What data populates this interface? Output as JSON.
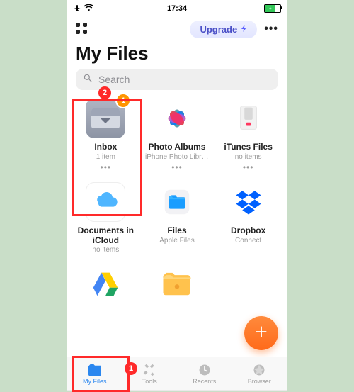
{
  "status": {
    "time": "17:34"
  },
  "header": {
    "upgrade_label": "Upgrade",
    "title": "My Files"
  },
  "search": {
    "placeholder": "Search"
  },
  "folders": [
    {
      "name": "Inbox",
      "sub": "1 item",
      "icon": "inbox",
      "badge": "1"
    },
    {
      "name": "Photo Albums",
      "sub": "iPhone Photo Libra...",
      "icon": "flower",
      "badge": null
    },
    {
      "name": "iTunes Files",
      "sub": "no items",
      "icon": "itunes",
      "badge": null
    },
    {
      "name": "Documents in iCloud",
      "sub": "no items",
      "icon": "doccloud",
      "badge": null
    },
    {
      "name": "Files",
      "sub": "Apple Files",
      "icon": "files",
      "badge": null
    },
    {
      "name": "Dropbox",
      "sub": "Connect",
      "icon": "dropbox",
      "badge": null
    },
    {
      "name": "",
      "sub": "",
      "icon": "gdrive",
      "badge": null
    },
    {
      "name": "",
      "sub": "",
      "icon": "folder",
      "badge": null
    }
  ],
  "tabs": [
    {
      "label": "My Files"
    },
    {
      "label": "Tools"
    },
    {
      "label": "Recents"
    },
    {
      "label": "Browser"
    }
  ],
  "annotations": {
    "circle1": "1",
    "circle2": "2"
  }
}
